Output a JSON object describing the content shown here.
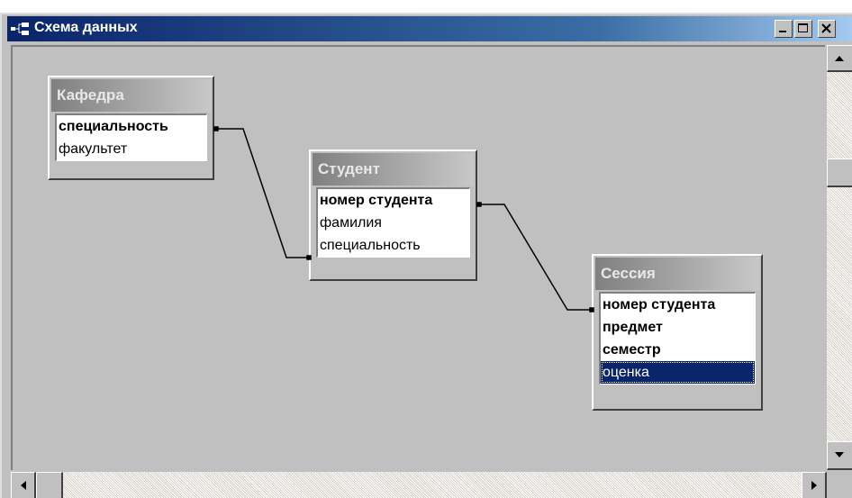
{
  "window": {
    "title": "Схема данных"
  },
  "tables": [
    {
      "name": "Кафедра",
      "fields": [
        {
          "label": "специальность",
          "key": true
        },
        {
          "label": "факультет",
          "key": false
        }
      ]
    },
    {
      "name": "Студент",
      "fields": [
        {
          "label": "номер студента",
          "key": true
        },
        {
          "label": "фамилия",
          "key": false
        },
        {
          "label": "специальность",
          "key": false
        }
      ]
    },
    {
      "name": "Сессия",
      "fields": [
        {
          "label": "номер студента",
          "key": true
        },
        {
          "label": "предмет",
          "key": true
        },
        {
          "label": "семестр",
          "key": true
        },
        {
          "label": "оценка",
          "key": false,
          "selected": true
        }
      ]
    }
  ],
  "icons": {
    "app": "relationships-icon",
    "minimize": "minimize-icon",
    "maximize": "maximize-icon",
    "close": "close-icon",
    "scroll_up": "arrow-up-icon",
    "scroll_down": "arrow-down-icon",
    "scroll_left": "arrow-left-icon",
    "scroll_right": "arrow-right-icon"
  },
  "colors": {
    "titlebar": "#0a246a",
    "selection": "#0a246a",
    "canvas": "#c0c0c0"
  }
}
